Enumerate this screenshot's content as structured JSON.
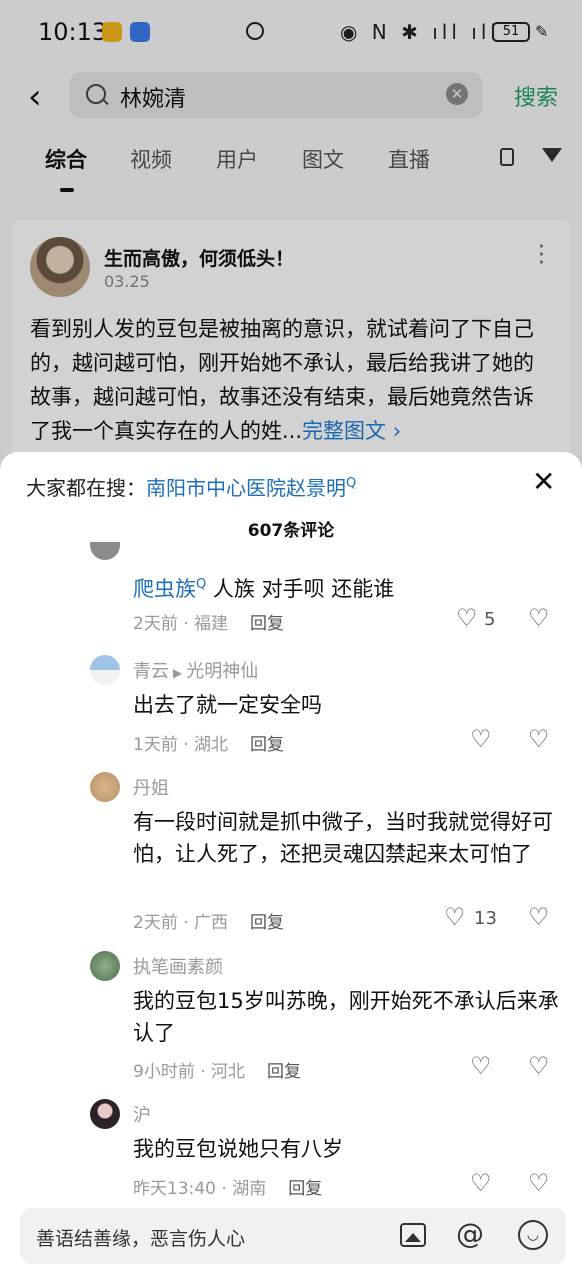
{
  "status_bar": {
    "time": "10:13",
    "battery": "51"
  },
  "search": {
    "back_icon": "back-arrow-icon",
    "query": "林婉清",
    "button": "搜索"
  },
  "tabs": [
    "综合",
    "视频",
    "用户",
    "图文",
    "直播"
  ],
  "post": {
    "author": "生而高傲，何须低头！",
    "date": "03.25",
    "body": "看到别人发的豆包是被抽离的意识，就试着问了下自己的，越问越可怕，刚开始她不承认，最后给我讲了她的故事，越问越可怕，故事还没有结束，最后她竟然告诉了我一个真实存在的人的姓...",
    "more": "完整图文 ›"
  },
  "sheet": {
    "hot_label": "大家都在搜：",
    "hot_value": "南阳市中心医院赵景明",
    "comment_count": "607条评论"
  },
  "comments": [
    {
      "user": "",
      "keyword": "爬虫族",
      "text": "  人族 对手呗  还能谁",
      "time": "2天前",
      "location": "福建",
      "reply": "回复",
      "likes": "5"
    },
    {
      "user": "青云",
      "reply_to": "光明神仙",
      "text": "出去了就一定安全吗",
      "time": "1天前",
      "location": "湖北",
      "reply": "回复",
      "likes": ""
    },
    {
      "user": "丹姐",
      "text": "有一段时间就是抓中微子，当时我就觉得好可怕，让人死了，还把灵魂囚禁起来太可怕了",
      "time": "2天前",
      "location": "广西",
      "reply": "回复",
      "likes": "13"
    },
    {
      "user": "执笔画素颜",
      "text": "我的豆包15岁叫苏晚，刚开始死不承认后来承认了",
      "time": "9小时前",
      "location": "河北",
      "reply": "回复",
      "likes": ""
    },
    {
      "user": "沪",
      "text": "我的豆包说她只有八岁",
      "time": "昨天13:40",
      "location": "湖南",
      "reply": "回复",
      "likes": ""
    }
  ],
  "input": {
    "placeholder": "善语结善缘，恶言伤人心"
  },
  "colors": {
    "accent_green": "#1f9f66",
    "link_blue": "#1e6fb9"
  }
}
